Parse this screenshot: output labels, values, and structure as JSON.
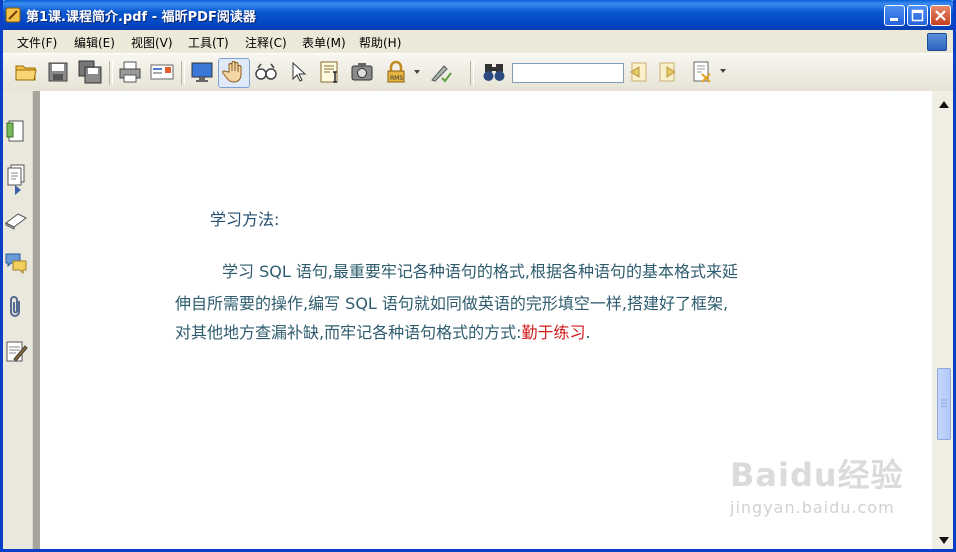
{
  "window": {
    "title": "第1课.课程简介.pdf - 福昕PDF阅读器"
  },
  "menu": {
    "items": [
      "文件(F)",
      "编辑(E)",
      "视图(V)",
      "工具(T)",
      "注释(C)",
      "表单(M)",
      "帮助(H)"
    ]
  },
  "toolbar": {
    "icons": [
      "open-folder-icon",
      "save-icon",
      "save-all-icon",
      "print-icon",
      "email-icon",
      "fullscreen-monitor-icon",
      "hand-tool-icon",
      "zoom-glasses-icon",
      "select-arrow-icon",
      "text-select-icon",
      "snapshot-camera-icon",
      "rms-lock-icon",
      "sign-icon",
      "find-binoculars-icon",
      "find-previous-icon",
      "find-next-icon",
      "clear-search-icon"
    ],
    "search_value": ""
  },
  "sidebar": {
    "icons": [
      "bookmarks-icon",
      "pages-icon",
      "layers-icon",
      "comments-icon",
      "attachments-icon",
      "signature-icon"
    ]
  },
  "document": {
    "heading": "学习方法:",
    "paragraph_lines": [
      "学习 SQL 语句,最重要牢记各种语句的格式,根据各种语句的基本格式来延",
      "伸自所需要的操作,编写 SQL 语句就如同做英语的完形填空一样,搭建好了框架,",
      "对其他地方查漏补缺,而牢记各种语句格式的方式:"
    ],
    "highlight": "勤于练习",
    "end_punct": "."
  },
  "watermark": {
    "main": "Baidu经验",
    "sub": "jingyan.baidu.com"
  },
  "colors": {
    "titlebar": "#0a57d0",
    "doc_text": "#2e5c6e",
    "highlight": "#d01a1a"
  }
}
